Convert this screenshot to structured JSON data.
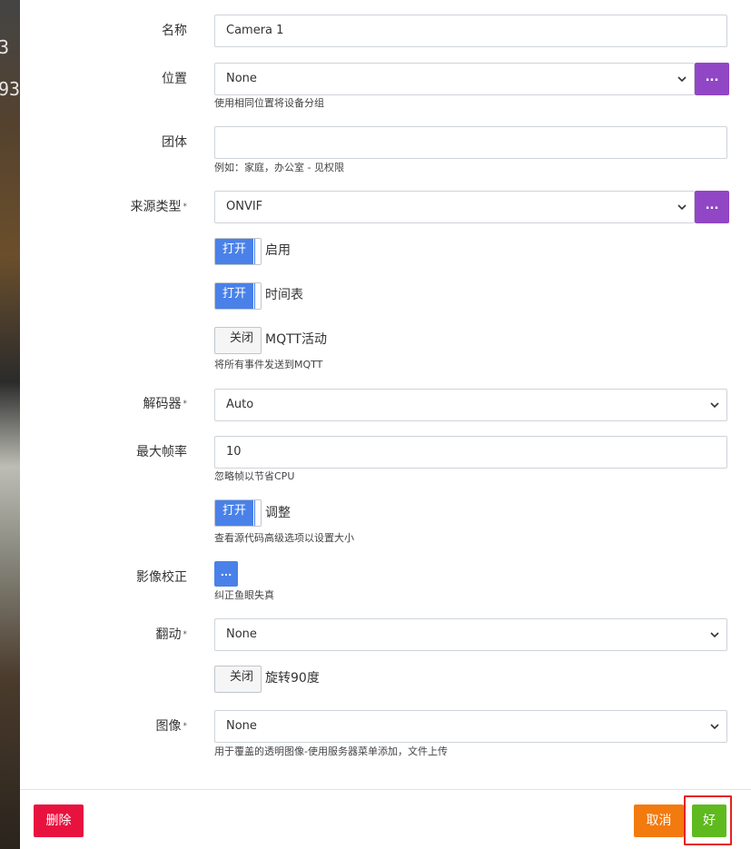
{
  "background_overlay": {
    "digit_top": "3",
    "digit_mid": "93"
  },
  "form": {
    "name": {
      "label": "名称",
      "value": "Camera 1"
    },
    "location": {
      "label": "位置",
      "value": "None",
      "button": "...",
      "help": "使用相同位置将设备分组"
    },
    "group": {
      "label": "团体",
      "value": "",
      "help": "例如：家庭，办公室 - 见权限"
    },
    "source_type": {
      "label": "来源类型",
      "required": "*",
      "value": "ONVIF",
      "button": "..."
    },
    "enabled": {
      "toggle": "打开",
      "label": "启用"
    },
    "schedule": {
      "toggle": "打开",
      "label": "时间表"
    },
    "mqtt": {
      "toggle": "关闭",
      "label": "MQTT活动",
      "help": "将所有事件发送到MQTT"
    },
    "decoder": {
      "label": "解码器",
      "required": "*",
      "value": "Auto"
    },
    "max_fps": {
      "label": "最大帧率",
      "value": "10",
      "help": "忽略帧以节省CPU"
    },
    "resize": {
      "toggle": "打开",
      "label": "调整",
      "help": "查看源代码高级选项以设置大小"
    },
    "dewarp": {
      "label": "影像校正",
      "button": "...",
      "help": "纠正鱼眼失真"
    },
    "flip": {
      "label": "翻动",
      "required": "*",
      "value": "None"
    },
    "rotate": {
      "toggle": "关闭",
      "label": "旋转90度"
    },
    "image": {
      "label": "图像",
      "required": "*",
      "value": "None",
      "help": "用于覆盖的透明图像-使用服务器菜单添加，文件上传"
    }
  },
  "footer": {
    "delete": "删除",
    "cancel": "取消",
    "ok": "好"
  },
  "colors": {
    "purple_button": "#9146c6",
    "toggle_on": "#4a81e8",
    "delete": "#e8123f",
    "cancel": "#f37a0e",
    "ok": "#5fba1f",
    "highlight": "#e52222"
  }
}
